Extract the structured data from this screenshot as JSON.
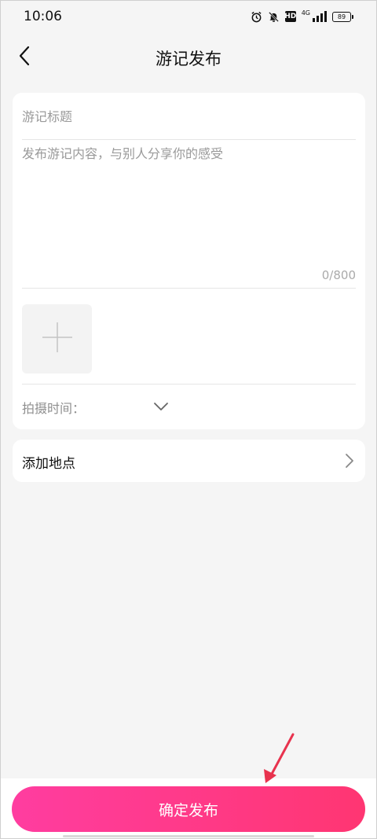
{
  "status_bar": {
    "time": "10:06",
    "network": "4G",
    "battery": "89"
  },
  "header": {
    "title": "游记发布"
  },
  "form": {
    "title_placeholder": "游记标题",
    "content_placeholder": "发布游记内容，与别人分享你的感受",
    "char_counter": "0/800",
    "shoot_time_label": "拍摄时间："
  },
  "location": {
    "label": "添加地点"
  },
  "footer": {
    "publish_label": "确定发布"
  },
  "colors": {
    "accent_start": "#ff3da0",
    "accent_end": "#ff3672",
    "annotation_arrow": "#e8334e"
  }
}
